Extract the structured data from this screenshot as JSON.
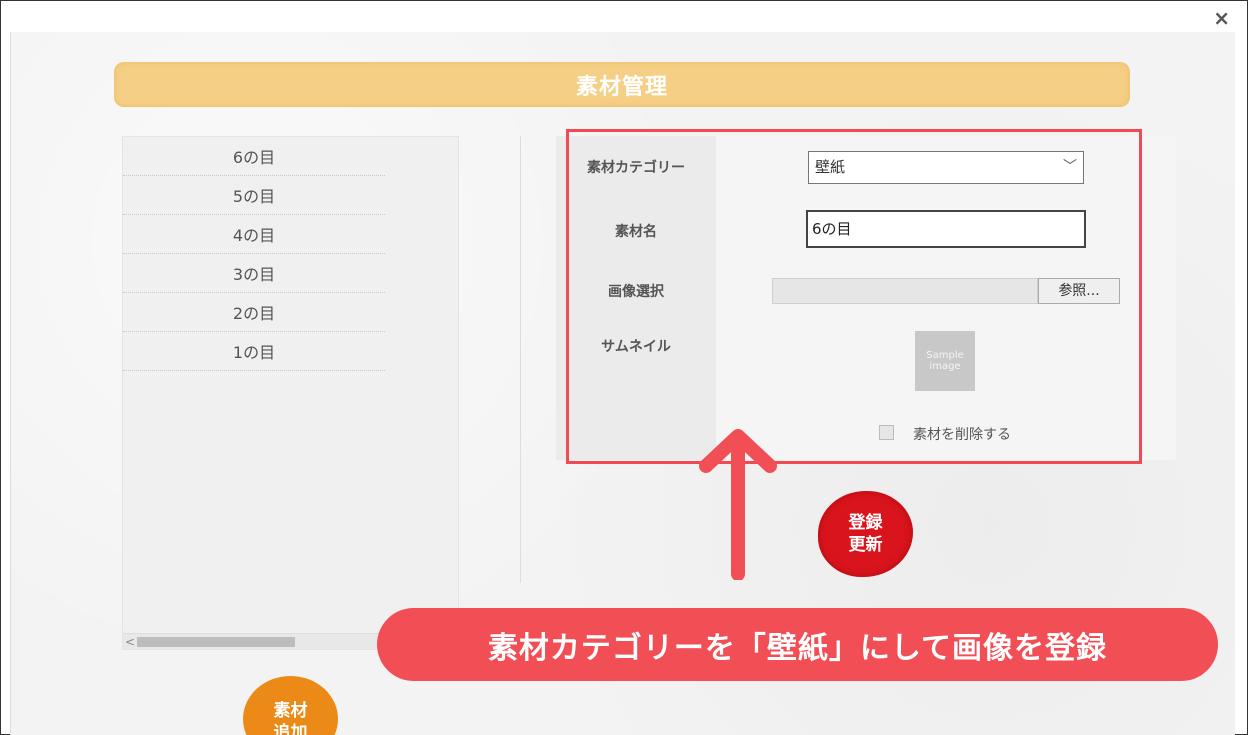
{
  "window": {
    "close_label": "×"
  },
  "title": "素材管理",
  "list": {
    "items": [
      "6の目",
      "5の目",
      "4の目",
      "3の目",
      "2の目",
      "1の目"
    ],
    "scroll_left_arrow": "<"
  },
  "form": {
    "category": {
      "label": "素材カテゴリー",
      "selected": "壁紙",
      "chevron": "﹀"
    },
    "name": {
      "label": "素材名",
      "value": "6の目"
    },
    "image": {
      "label": "画像選択",
      "browse_label": "参照..."
    },
    "thumbnail": {
      "label": "サムネイル",
      "sample_line1": "Sample",
      "sample_line2": "image"
    },
    "delete": {
      "label": "素材を削除する",
      "checked": false
    }
  },
  "register_button": {
    "line1": "登録",
    "line2": "更新"
  },
  "add_button": {
    "line1": "素材",
    "line2": "追加"
  },
  "callout": {
    "text": "素材カテゴリーを「壁紙」にして画像を登録"
  },
  "colors": {
    "title_bar": "#f5cf86",
    "highlight": "#f04a55",
    "register": "#d9141c",
    "add": "#ec8a17",
    "callout": "#f24e55"
  }
}
